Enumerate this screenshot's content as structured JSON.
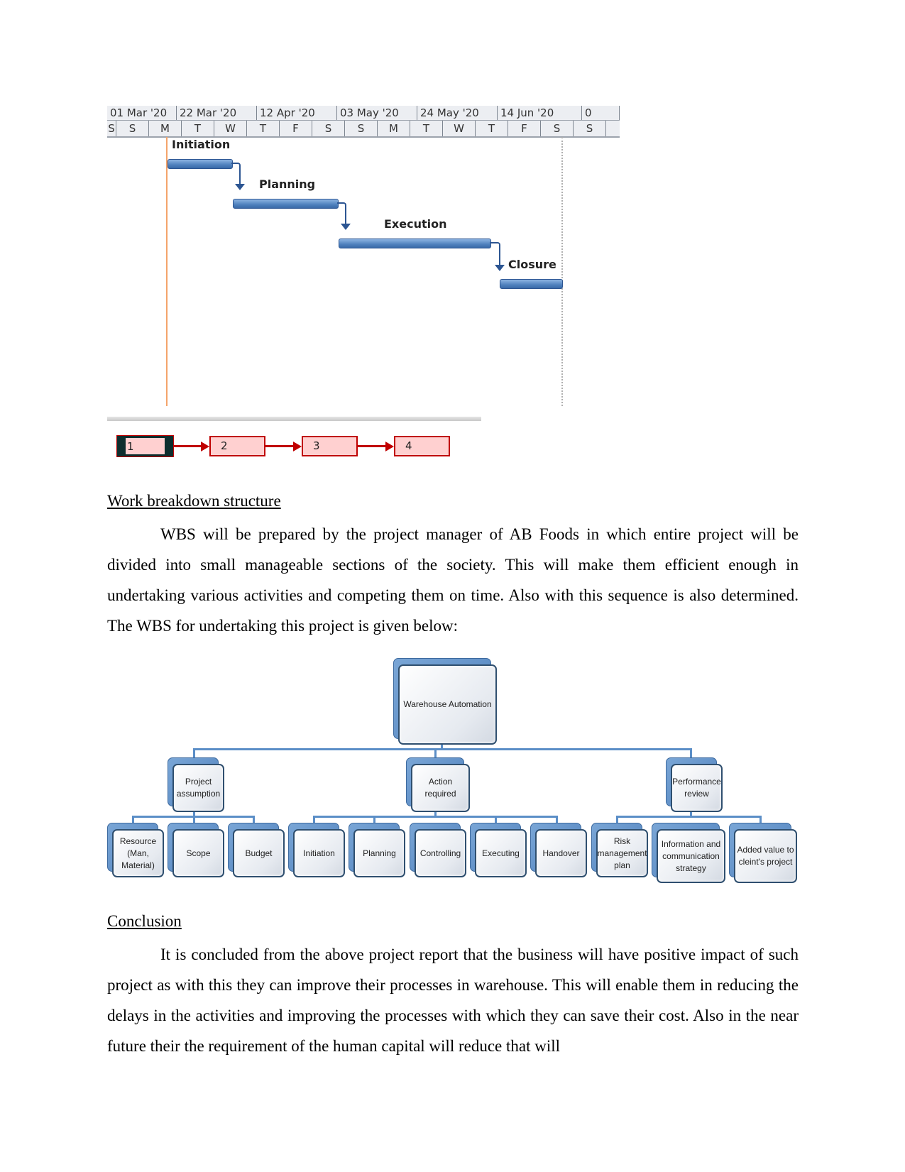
{
  "gantt": {
    "timescale_top": [
      "01 Mar '20",
      "22 Mar '20",
      "12 Apr '20",
      "03 May '20",
      "24 May '20",
      "14 Jun '20",
      "0"
    ],
    "timescale_bottom": [
      "S",
      "S",
      "M",
      "T",
      "W",
      "T",
      "F",
      "S",
      "S",
      "M",
      "T",
      "W",
      "T",
      "F",
      "S",
      "S"
    ],
    "tasks": [
      {
        "label": "Initiation"
      },
      {
        "label": "Planning"
      },
      {
        "label": "Execution"
      },
      {
        "label": "Closure"
      }
    ]
  },
  "network": {
    "nodes": [
      "1",
      "2",
      "3",
      "4"
    ]
  },
  "wbs_section": {
    "heading": "Work breakdown structure",
    "paragraph": "WBS will be prepared by the project manager of AB Foods in which entire project will be divided into small manageable sections of the society. This will make them efficient enough in undertaking various activities and competing them on time. Also with this sequence is also determined. The WBS for undertaking this project is given below:"
  },
  "wbs": {
    "root": "Warehouse Automation",
    "level1": [
      "Project assumption",
      "Action required",
      "Performance review"
    ],
    "level2": [
      "Resource (Man, Material)",
      "Scope",
      "Budget",
      "Initiation",
      "Planning",
      "Controlling",
      "Executing",
      "Handover",
      "Risk management plan",
      "Information and communication strategy",
      "Added value to cleint's project"
    ]
  },
  "conclusion": {
    "heading": "Conclusion",
    "paragraph": "It is concluded from the above project report that the business will have positive impact of such project as with this they can improve their processes in warehouse. This will enable them in reducing the delays in the activities and improving the processes with which they can save their cost. Also in the near future their the requirement of the human capital will reduce that will"
  }
}
